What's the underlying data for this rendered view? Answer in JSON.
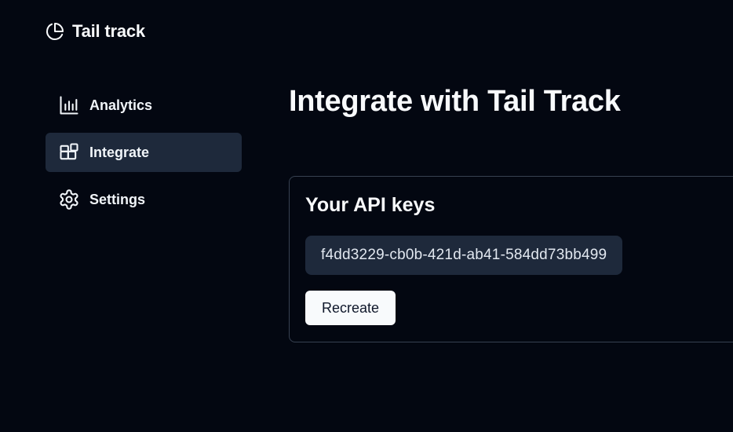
{
  "brand": {
    "name": "Tail track",
    "icon": "pie-chart-icon"
  },
  "sidebar": {
    "items": [
      {
        "label": "Analytics",
        "icon": "bar-chart-icon",
        "active": false
      },
      {
        "label": "Integrate",
        "icon": "blocks-icon",
        "active": true
      },
      {
        "label": "Settings",
        "icon": "gear-icon",
        "active": false
      }
    ]
  },
  "main": {
    "title": "Integrate with Tail Track",
    "api_card": {
      "title": "Your API keys",
      "key": "f4dd3229-cb0b-421d-ab41-584dd73bb499",
      "recreate_label": "Recreate"
    }
  },
  "colors": {
    "background": "#030711",
    "active_nav": "#1e293b",
    "key_background": "#1e293b",
    "card_border": "#374151",
    "button_background": "#f8fafc",
    "button_text": "#0f172a",
    "text": "#f8fafc"
  }
}
